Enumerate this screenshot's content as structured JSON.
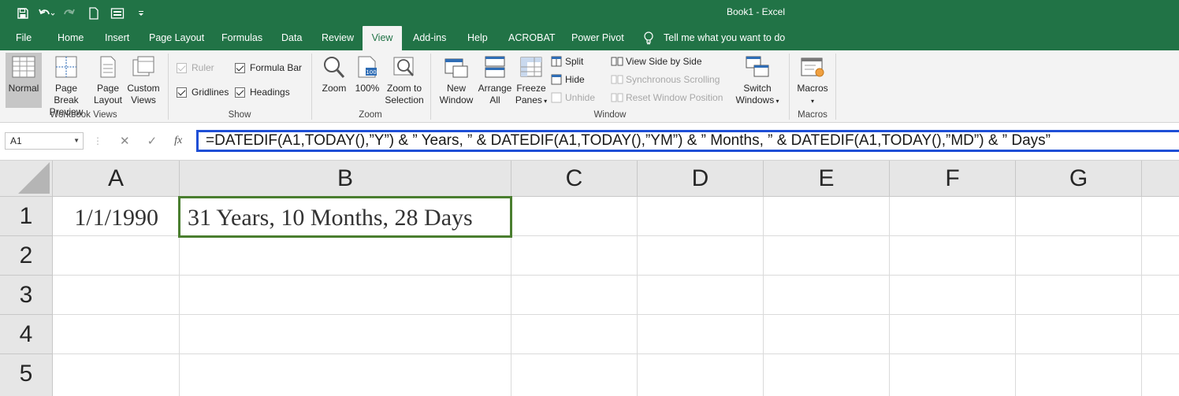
{
  "title_bar": {
    "title": "Book1  -  Excel",
    "qat_icons": [
      "save-icon",
      "undo-icon",
      "redo-icon",
      "new-document-icon",
      "form-icon",
      "customize-qat-icon"
    ]
  },
  "tabs": [
    "File",
    "Home",
    "Insert",
    "Page Layout",
    "Formulas",
    "Data",
    "Review",
    "View",
    "Add-ins",
    "Help",
    "ACROBAT",
    "Power Pivot"
  ],
  "active_tab": "View",
  "tell_me": "Tell me what you want to do",
  "ribbon": {
    "workbook_views": {
      "label": "Workbook Views",
      "normal": "Normal",
      "page_break_1": "Page Break",
      "page_break_2": "Preview",
      "page_layout_1": "Page",
      "page_layout_2": "Layout",
      "custom_views_1": "Custom",
      "custom_views_2": "Views"
    },
    "show": {
      "label": "Show",
      "ruler": "Ruler",
      "formula_bar": "Formula Bar",
      "gridlines": "Gridlines",
      "headings": "Headings"
    },
    "zoom": {
      "label": "Zoom",
      "zoom": "Zoom",
      "hundred": "100%",
      "zoom_sel_1": "Zoom to",
      "zoom_sel_2": "Selection"
    },
    "window": {
      "label": "Window",
      "new_window_1": "New",
      "new_window_2": "Window",
      "arrange_1": "Arrange",
      "arrange_2": "All",
      "freeze_1": "Freeze",
      "freeze_2": "Panes",
      "split": "Split",
      "hide": "Hide",
      "unhide": "Unhide",
      "side_by_side": "View Side by Side",
      "sync_scroll": "Synchronous Scrolling",
      "reset_pos": "Reset Window Position",
      "switch_1": "Switch",
      "switch_2": "Windows"
    },
    "macros": {
      "label": "Macros",
      "macros": "Macros"
    }
  },
  "formula_bar": {
    "name_box": "A1",
    "cancel": "✕",
    "enter": "✓",
    "fx": "fx",
    "formula": "=DATEDIF(A1,TODAY(),”Y”) & ” Years, ” & DATEDIF(A1,TODAY(),”YM”) & ” Months, ” & DATEDIF(A1,TODAY(),”MD”) & ” Days”"
  },
  "sheet": {
    "columns": [
      "A",
      "B",
      "C",
      "D",
      "E",
      "F",
      "G"
    ],
    "rows": [
      "1",
      "2",
      "3",
      "4",
      "5"
    ],
    "cells": {
      "A1": "1/1/1990",
      "B1": "31 Years, 10 Months, 28 Days"
    },
    "selected_cell": "B1"
  },
  "colors": {
    "accent": "#217346",
    "formula_border": "#1f4fd6",
    "selection_border": "#4a7e2f"
  }
}
